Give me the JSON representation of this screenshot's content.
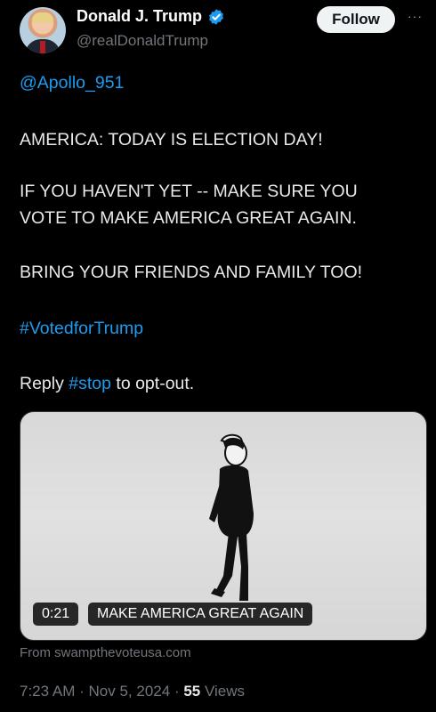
{
  "post": {
    "author_name": "Donald J. Trump",
    "author_handle": "@realDonaldTrump",
    "follow_label": "Follow",
    "more_label": "···",
    "mention": "@Apollo_951",
    "line1": "AMERICA: TODAY IS ELECTION DAY!",
    "line2": "IF YOU HAVEN'T YET -- MAKE SURE YOU",
    "line3": "VOTE TO MAKE AMERICA GREAT AGAIN.",
    "line4": "BRING YOUR FRIENDS AND FAMILY TOO!",
    "hashtag": "#VotedforTrump",
    "reply_prefix": "Reply",
    "reply_tag": "#stop",
    "reply_suffix": "to opt-out.",
    "media": {
      "duration": "0:21",
      "caption": "MAKE AMERICA GREAT AGAIN"
    },
    "source": "From swampthevoteusa.com",
    "time": "7:23 AM",
    "separator": "·",
    "date": "Nov 5, 2024",
    "views_count": "55",
    "views_label": "Views"
  },
  "colors": {
    "background": "#000000",
    "link": "#1d9bf0",
    "muted": "#71767b",
    "verified": "#1d9bf0"
  },
  "icons": [
    "verified-badge-icon",
    "more-options-icon"
  ]
}
